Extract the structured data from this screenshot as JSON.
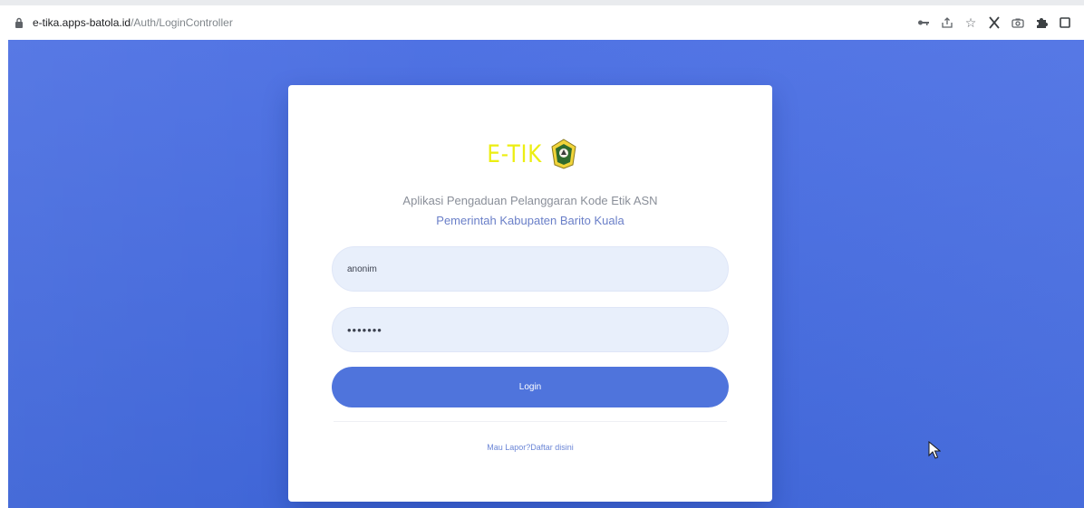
{
  "browser": {
    "url_host": "e-tika.apps-batola.id",
    "url_path": "/Auth/LoginController",
    "icons": [
      "key-icon",
      "share-icon",
      "star-icon",
      "x-icon",
      "camera-icon",
      "puzzle-icon",
      "window-icon"
    ]
  },
  "login": {
    "logo_text": "E-TIK",
    "subtitle": "Aplikasi Pengaduan Pelanggaran Kode Etik ASN",
    "subtitle2": "Pemerintah Kabupaten Barito Kuala",
    "username_value": "anonim",
    "password_value": "•••••••",
    "login_button": "Login",
    "register_link": "Mau Lapor?Daftar disini"
  },
  "colors": {
    "page_background": "#4a6ddf",
    "button": "#4f74dc",
    "input_background": "#e8effb",
    "logo_text": "#ecee12"
  }
}
